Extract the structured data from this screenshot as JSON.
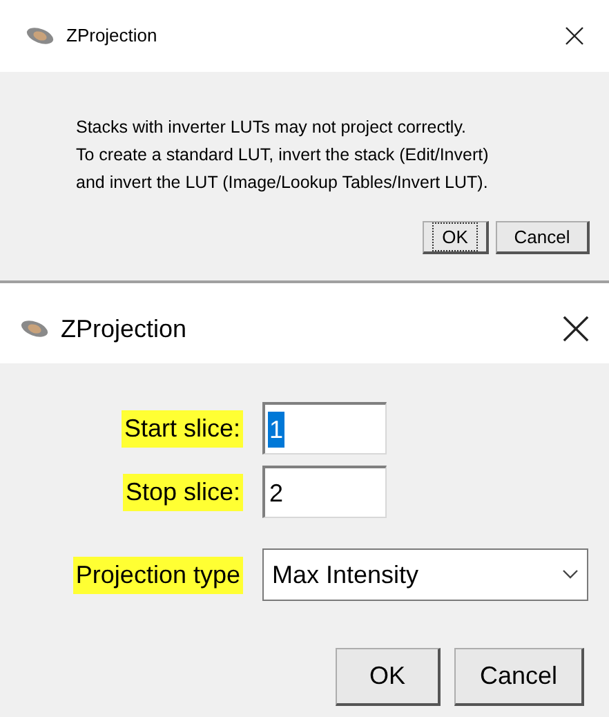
{
  "dialogs": [
    {
      "title": "ZProjection",
      "kind": "message",
      "message": [
        "Stacks with inverter LUTs may not project correctly.",
        "To create a standard LUT, invert the stack (Edit/Invert)",
        "and invert the LUT (Image/Lookup Tables/Invert LUT)."
      ],
      "buttons": [
        {
          "label": "OK",
          "focused": true
        },
        {
          "label": "Cancel",
          "focused": false
        }
      ]
    },
    {
      "title": "ZProjection",
      "kind": "form",
      "fields": [
        {
          "kind": "text",
          "label": "Start slice:",
          "highlighted": true,
          "value": "1",
          "selected": true
        },
        {
          "kind": "text",
          "label": "Stop slice:",
          "highlighted": true,
          "value": "2",
          "selected": false
        },
        {
          "kind": "select",
          "label": "Projection type",
          "highlighted": true,
          "value": "Max Intensity"
        }
      ],
      "buttons": [
        {
          "label": "OK",
          "focused": false
        },
        {
          "label": "Cancel",
          "focused": false
        }
      ]
    }
  ]
}
